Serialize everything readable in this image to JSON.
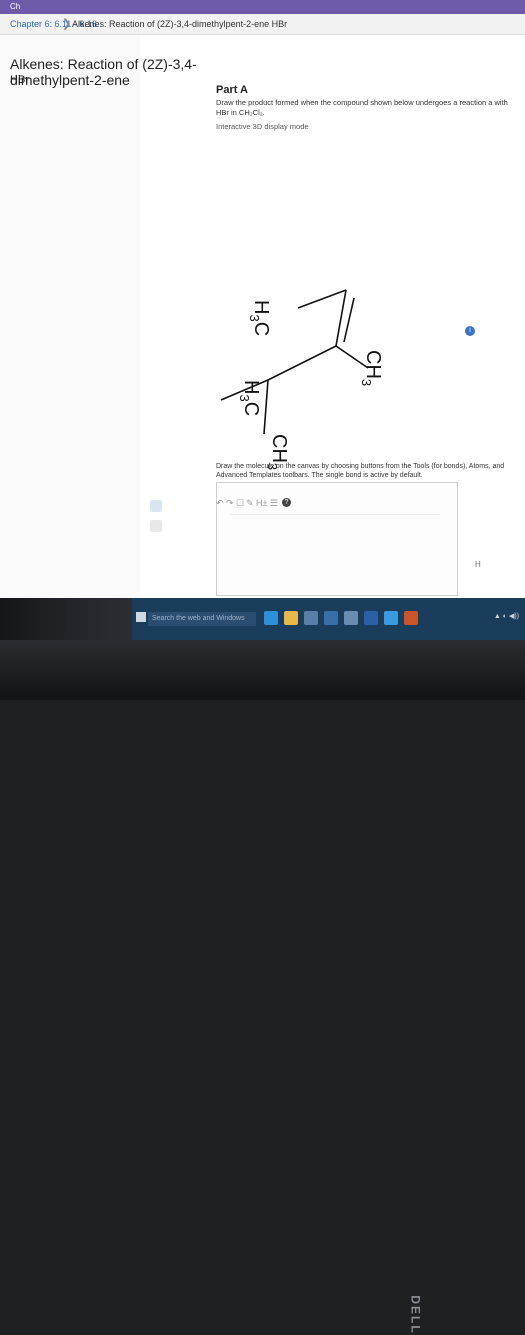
{
  "browser": {
    "tab_icon": "Ch"
  },
  "breadcrumb": {
    "chapter": "Chapter 6: 6.11 - 6.16",
    "separator": "❯",
    "title": "Alkenes: Reaction of (2Z)-3,4-dimethylpent-2-ene HBr"
  },
  "document": {
    "title": "Alkenes: Reaction of (2Z)-3,4-dimethylpent-2-ene",
    "subtitle": "HBr"
  },
  "part": {
    "label": "Part A",
    "instruction": "Draw the product formed when the compound shown below undergoes a reaction a with HBr in CH₂Cl₂.",
    "display_mode": "Interactive 3D display mode",
    "info_icon": "info-icon"
  },
  "molecule": {
    "labels": {
      "h3c_top": {
        "main": "H",
        "sub": "3",
        "tail": "C"
      },
      "ch3_top": {
        "main": "CH",
        "sub": "3"
      },
      "h3c_bottom": {
        "main": "H",
        "sub": "3",
        "tail": "C"
      },
      "ch3_bottom": {
        "main": "CH",
        "sub": "3"
      }
    }
  },
  "editor": {
    "draw_instruction": "Draw the molecule on the canvas by choosing buttons from the Tools (for bonds), Atoms, and Advanced Templates toolbars. The single bond is active by default.",
    "tools": [
      "↶",
      "↷",
      "☐",
      "✎",
      "H±",
      "☰"
    ],
    "help_icon": "?",
    "h_label": "H"
  },
  "taskbar": {
    "search_placeholder": "Search the web and Windows"
  },
  "device": {
    "brand": "DELL"
  },
  "colors": {
    "tab_purple": "#6d5aa8",
    "link_blue": "#2f6db5",
    "taskbar_blue": "#1b3d5c"
  }
}
